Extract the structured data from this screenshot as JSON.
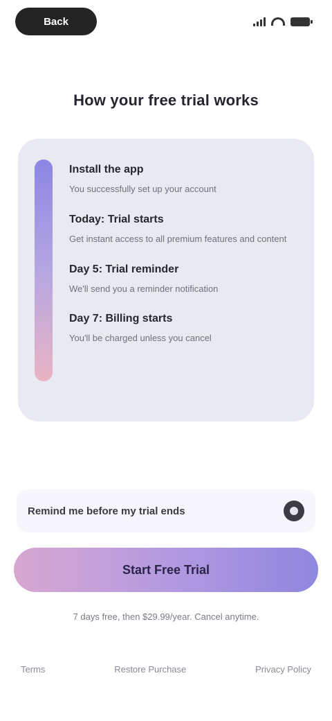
{
  "status_bar": {
    "back_label": "Back"
  },
  "heading": "How your free trial works",
  "timeline": {
    "steps": [
      {
        "title": "Install the app",
        "desc": "You successfully set up your account"
      },
      {
        "title": "Today: Trial starts",
        "desc": "Get instant access to all premium features and content"
      },
      {
        "title": "Day 5: Trial reminder",
        "desc": "We'll send you a reminder notification"
      },
      {
        "title": "Day 7: Billing starts",
        "desc": "You'll be charged unless you cancel"
      }
    ]
  },
  "reminder": {
    "label": "Remind me before my trial ends"
  },
  "cta": {
    "label": "Start Free Trial"
  },
  "fine_print": "7 days free, then $29.99/year. Cancel anytime.",
  "footer": {
    "links": [
      "Terms",
      "Restore Purchase",
      "Privacy Policy"
    ]
  },
  "colors": {
    "card_bg": "#e8e9f1",
    "rail_top": "#8c86e4",
    "rail_bottom": "#eab3c4",
    "cta_start": "#d7a7d0",
    "cta_end": "#8f87df"
  }
}
